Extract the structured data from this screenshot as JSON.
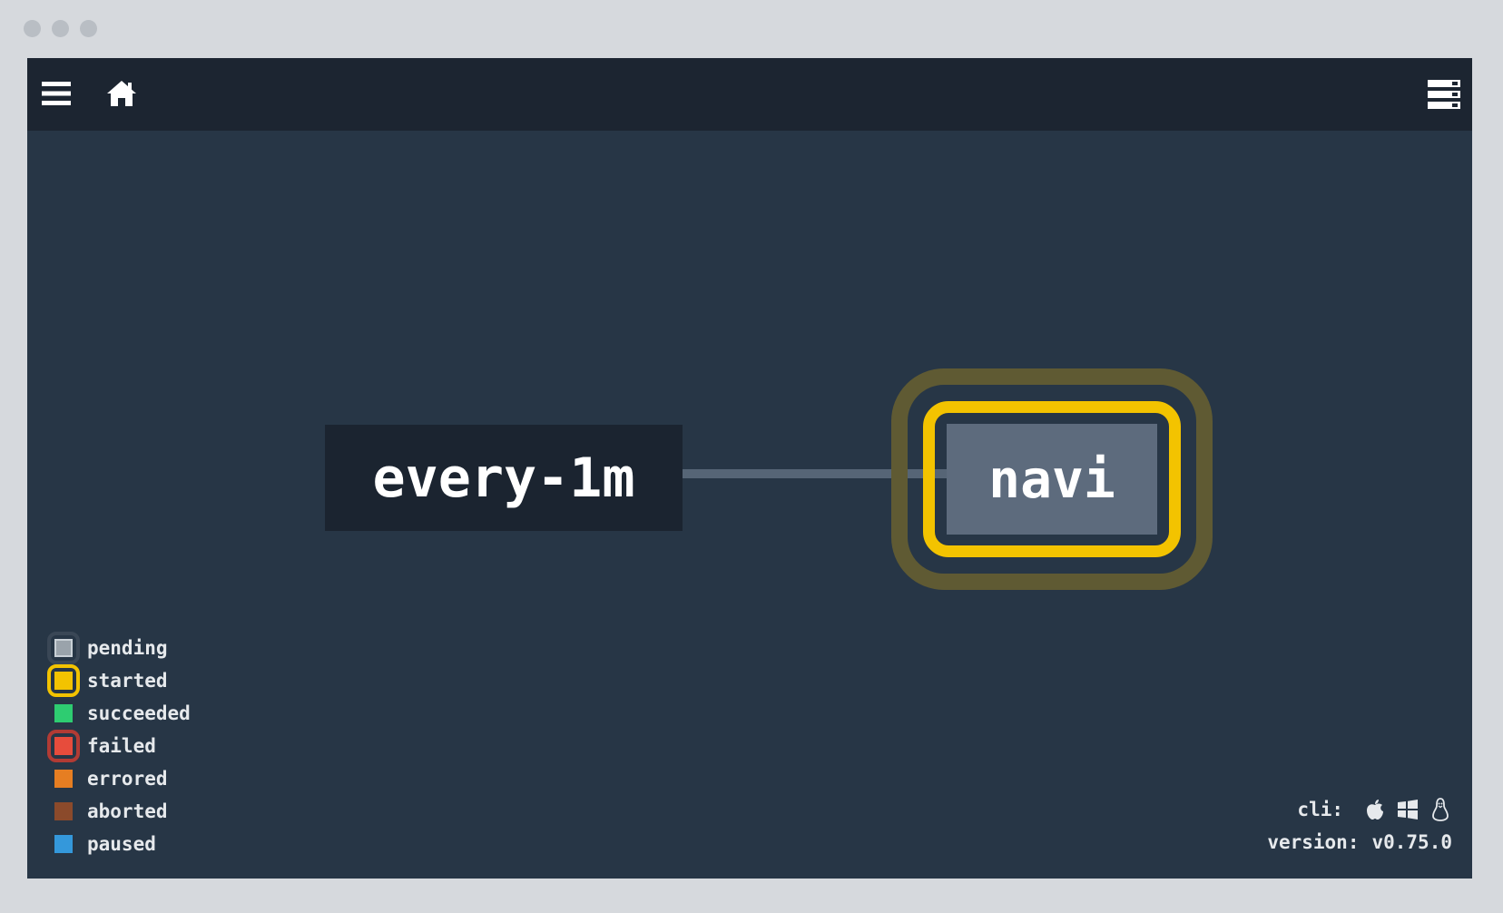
{
  "colors": {
    "background": "#273646",
    "topbar": "#1c2531",
    "started": "#f3c300",
    "pending": "#9aa3ab",
    "succeeded": "#2ecc71",
    "failed": "#e74c3c",
    "errored": "#e67e22",
    "aborted": "#8b4a2b",
    "paused": "#3498db"
  },
  "topbar": {
    "menu_icon": "hamburger-icon",
    "home_icon": "home-icon",
    "layout_icon": "group-list-icon"
  },
  "graph": {
    "resource": {
      "name": "every-1m"
    },
    "job": {
      "name": "navi",
      "status": "started"
    }
  },
  "legend": {
    "items": [
      {
        "label": "pending"
      },
      {
        "label": "started"
      },
      {
        "label": "succeeded"
      },
      {
        "label": "failed"
      },
      {
        "label": "errored"
      },
      {
        "label": "aborted"
      },
      {
        "label": "paused"
      }
    ]
  },
  "footer": {
    "cli_label": "cli:",
    "cli_icons": [
      "apple-icon",
      "windows-icon",
      "linux-icon"
    ],
    "version_label": "version:",
    "version_value": "v0.75.0"
  }
}
